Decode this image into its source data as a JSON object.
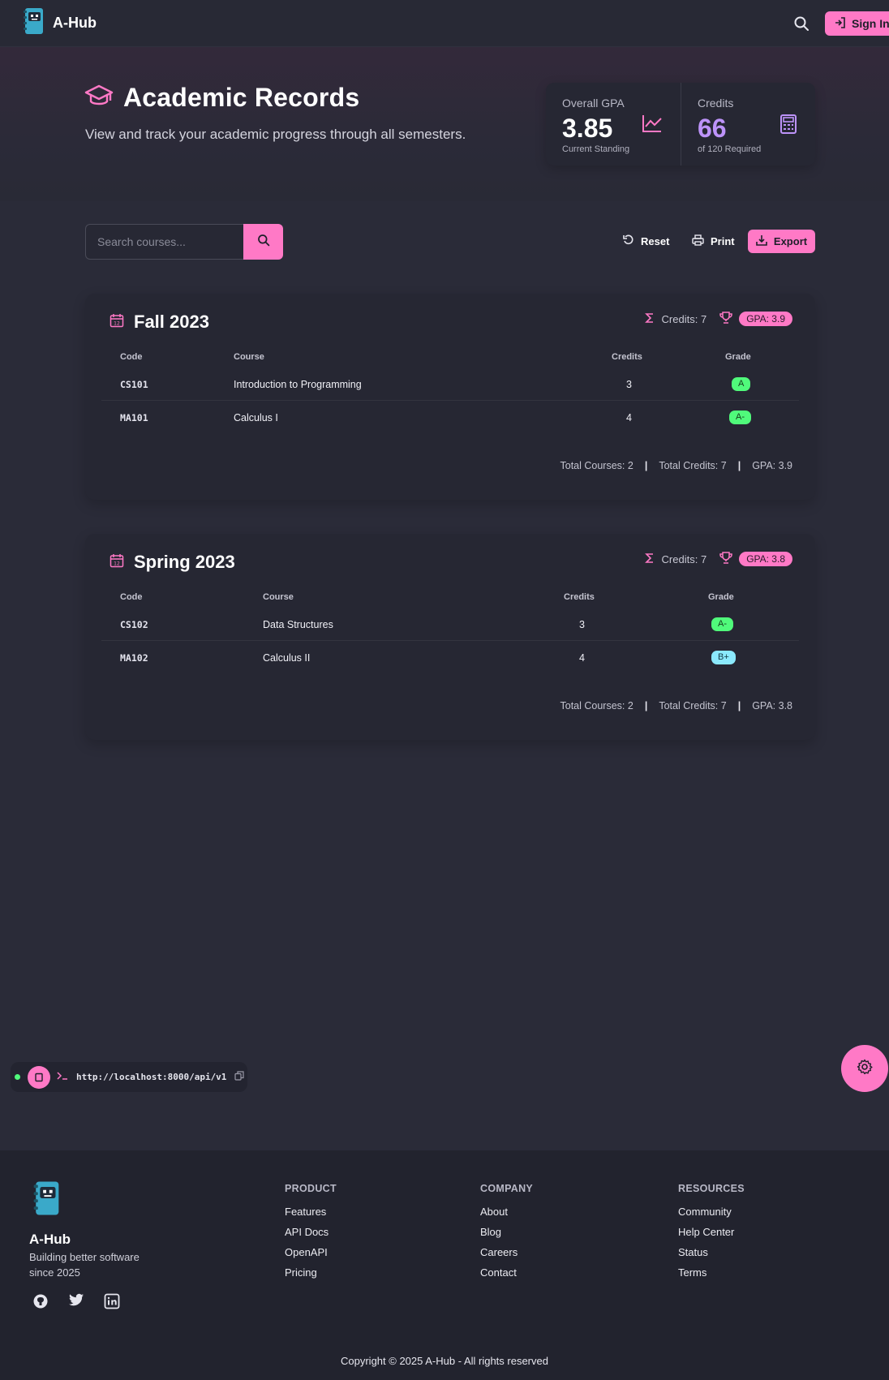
{
  "nav": {
    "brand": "A-Hub",
    "signin_label": "Sign In"
  },
  "hero": {
    "title": "Academic Records",
    "subtitle": "View and track your academic progress through all semesters.",
    "gpa": {
      "label": "Overall GPA",
      "value": "3.85",
      "note": "Current Standing"
    },
    "credits": {
      "label": "Credits",
      "value": "66",
      "note": "of 120 Required"
    }
  },
  "toolbar": {
    "search_placeholder": "Search courses...",
    "reset_label": "Reset",
    "print_label": "Print",
    "export_label": "Export"
  },
  "table_headers": {
    "code": "Code",
    "course": "Course",
    "credits": "Credits",
    "grade": "Grade"
  },
  "semesters": [
    {
      "title": "Fall 2023",
      "credits": "Credits: 7",
      "gpa": "GPA: 3.9",
      "courses": [
        {
          "code": "CS101",
          "name": "Introduction to Programming",
          "credits": "3",
          "grade": "A"
        },
        {
          "code": "MA101",
          "name": "Calculus I",
          "credits": "4",
          "grade": "A-"
        }
      ],
      "footer": {
        "total_courses": "Total Courses: 2",
        "total_credits": "Total Credits: 7",
        "gpa": "GPA: 3.9",
        "sep": "|"
      }
    },
    {
      "title": "Spring 2023",
      "credits": "Credits: 7",
      "gpa": "GPA: 3.8",
      "courses": [
        {
          "code": "CS102",
          "name": "Data Structures",
          "credits": "3",
          "grade": "A-"
        },
        {
          "code": "MA102",
          "name": "Calculus II",
          "credits": "4",
          "grade": "B+"
        }
      ],
      "footer": {
        "total_courses": "Total Courses: 2",
        "total_credits": "Total Credits: 7",
        "gpa": "GPA: 3.8",
        "sep": "|"
      }
    }
  ],
  "api": {
    "url": "http://localhost:8000/api/v1"
  },
  "footer": {
    "brand": "A-Hub",
    "tagline": "Building better software since 2025",
    "product": {
      "heading": "PRODUCT",
      "links": [
        "Features",
        "API Docs",
        "OpenAPI",
        "Pricing"
      ]
    },
    "company": {
      "heading": "COMPANY",
      "links": [
        "About",
        "Blog",
        "Careers",
        "Contact"
      ]
    },
    "resources": {
      "heading": "RESOURCES",
      "links": [
        "Community",
        "Help Center",
        "Status",
        "Terms"
      ]
    },
    "copyright": "Copyright © 2025 A-Hub - All rights reserved"
  },
  "colors": {
    "accent": "#ff79c6",
    "purple": "#bd93f9",
    "grade_green": "#50fa7b",
    "grade_blue": "#8be9fd",
    "background": "#2a2b38"
  },
  "icons": [
    "robot-notebook-logo-icon",
    "search-icon",
    "sign-in-icon",
    "graduation-cap-icon",
    "chart-line-icon",
    "calculator-icon",
    "reset-icon",
    "printer-icon",
    "download-icon",
    "calendar-icon",
    "sigma-icon",
    "trophy-icon",
    "terminal-icon",
    "copy-icon",
    "gear-icon",
    "github-icon",
    "twitter-icon",
    "linkedin-icon"
  ]
}
